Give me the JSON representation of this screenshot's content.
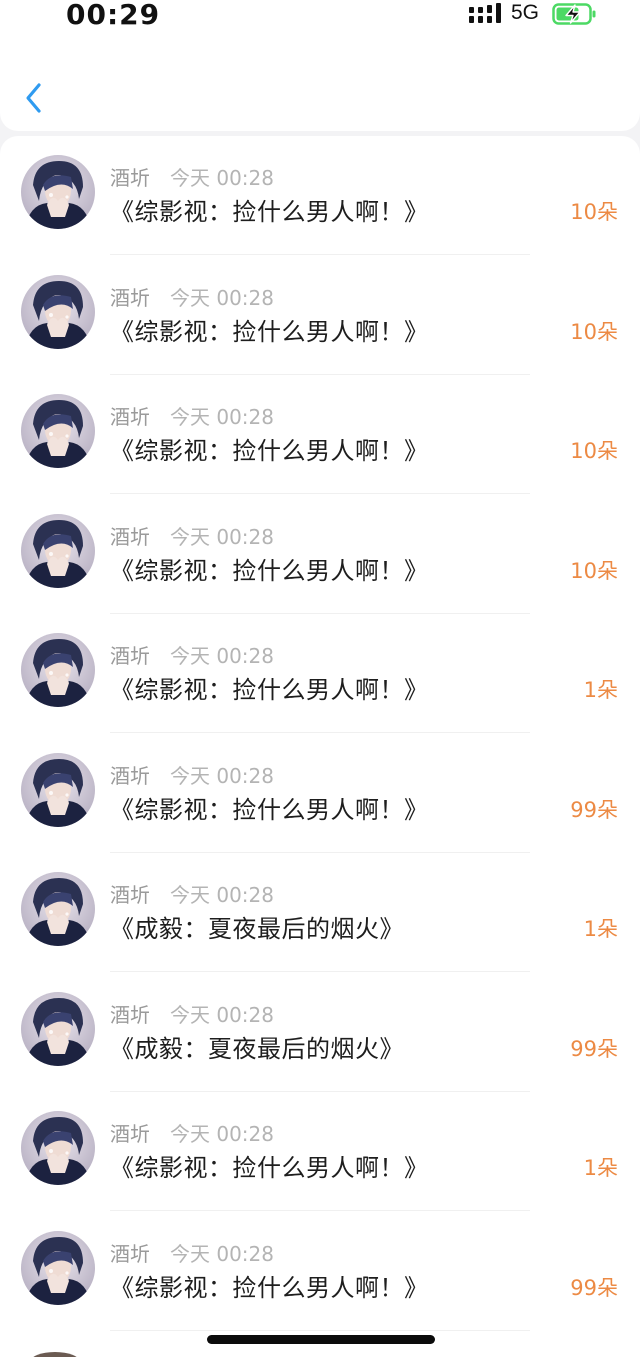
{
  "status_bar": {
    "time": "00:29",
    "network": "5G",
    "battery_charging": true,
    "signal_icon": "signal-bars-icon",
    "battery_icon": "battery-charging-icon",
    "battery_color": "#4cd964"
  },
  "header": {
    "back_icon": "chevron-left-icon",
    "back_color": "#2f9bf0"
  },
  "colors": {
    "gift_count": "#ec8a44",
    "username": "#9a9a9a",
    "timestamp": "#b4b4b4"
  },
  "records": [
    {
      "user": "酒圻",
      "time": "今天 00:28",
      "book": "《综影视：捡什么男人啊！》",
      "gift": "10朵"
    },
    {
      "user": "酒圻",
      "time": "今天 00:28",
      "book": "《综影视：捡什么男人啊！》",
      "gift": "10朵"
    },
    {
      "user": "酒圻",
      "time": "今天 00:28",
      "book": "《综影视：捡什么男人啊！》",
      "gift": "10朵"
    },
    {
      "user": "酒圻",
      "time": "今天 00:28",
      "book": "《综影视：捡什么男人啊！》",
      "gift": "10朵"
    },
    {
      "user": "酒圻",
      "time": "今天 00:28",
      "book": "《综影视：捡什么男人啊！》",
      "gift": "1朵"
    },
    {
      "user": "酒圻",
      "time": "今天 00:28",
      "book": "《综影视：捡什么男人啊！》",
      "gift": "99朵"
    },
    {
      "user": "酒圻",
      "time": "今天 00:28",
      "book": "《成毅：夏夜最后的烟火》",
      "gift": "1朵"
    },
    {
      "user": "酒圻",
      "time": "今天 00:28",
      "book": "《成毅：夏夜最后的烟火》",
      "gift": "99朵"
    },
    {
      "user": "酒圻",
      "time": "今天 00:28",
      "book": "《综影视：捡什么男人啊！》",
      "gift": "1朵"
    },
    {
      "user": "酒圻",
      "time": "今天 00:28",
      "book": "《综影视：捡什么男人啊！》",
      "gift": "99朵"
    }
  ]
}
